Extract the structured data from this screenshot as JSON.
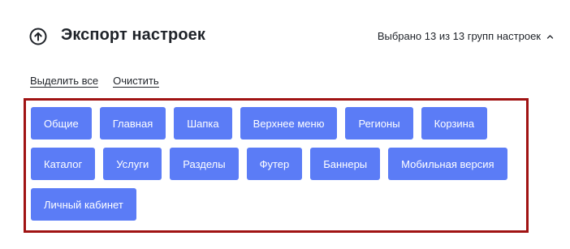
{
  "header": {
    "icon": "upload-circle-icon",
    "title": "Экспорт настроек",
    "selection_summary": "Выбрано 13 из 13 групп настроек",
    "chevron_icon": "chevron-up-icon"
  },
  "actions": {
    "select_all": "Выделить все",
    "clear": "Очистить"
  },
  "colors": {
    "chip_bg": "#5b7cf6",
    "chip_text": "#ffffff",
    "panel_border": "#a01313"
  },
  "groups": {
    "row1": [
      {
        "label": "Общие",
        "selected": true
      },
      {
        "label": "Главная",
        "selected": true
      },
      {
        "label": "Шапка",
        "selected": true
      },
      {
        "label": "Верхнее меню",
        "selected": true
      },
      {
        "label": "Регионы",
        "selected": true
      },
      {
        "label": "Корзина",
        "selected": true
      }
    ],
    "row2": [
      {
        "label": "Каталог",
        "selected": true
      },
      {
        "label": "Услуги",
        "selected": true
      },
      {
        "label": "Разделы",
        "selected": true
      },
      {
        "label": "Футер",
        "selected": true
      },
      {
        "label": "Баннеры",
        "selected": true
      },
      {
        "label": "Мобильная версия",
        "selected": true
      }
    ],
    "row3": [
      {
        "label": "Личный кабинет",
        "selected": true
      }
    ]
  }
}
